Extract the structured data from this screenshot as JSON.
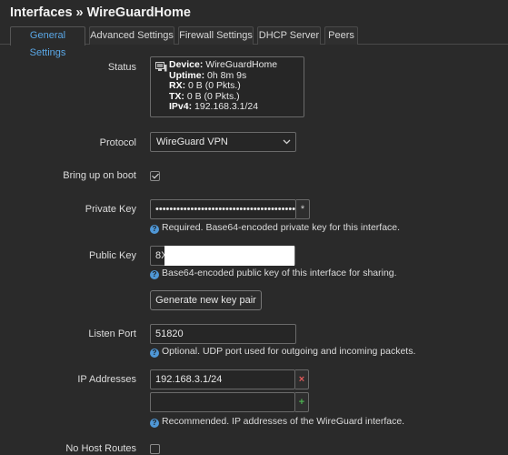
{
  "header": {
    "title": "Interfaces » WireGuardHome"
  },
  "tabs": [
    {
      "label": "General Settings",
      "active": true
    },
    {
      "label": "Advanced Settings",
      "active": false
    },
    {
      "label": "Firewall Settings",
      "active": false
    },
    {
      "label": "DHCP Server",
      "active": false
    },
    {
      "label": "Peers",
      "active": false
    }
  ],
  "status": {
    "label": "Status",
    "device_key": "Device:",
    "device_val": "WireGuardHome",
    "uptime_key": "Uptime:",
    "uptime_val": "0h 8m 9s",
    "rx_key": "RX:",
    "rx_val": "0 B (0 Pkts.)",
    "tx_key": "TX:",
    "tx_val": "0 B (0 Pkts.)",
    "ipv4_key": "IPv4:",
    "ipv4_val": "192.168.3.1/24"
  },
  "protocol": {
    "label": "Protocol",
    "value": "WireGuard VPN"
  },
  "bring_up": {
    "label": "Bring up on boot",
    "checked": true
  },
  "private_key": {
    "label": "Private Key",
    "value": "••••••••••••••••••••••••••••••••••••••••••••",
    "reveal": "*",
    "hint": "Required. Base64-encoded private key for this interface."
  },
  "public_key": {
    "label": "Public Key",
    "value": "8X",
    "hint": "Base64-encoded public key of this interface for sharing."
  },
  "generate_button": "Generate new key pair",
  "listen_port": {
    "label": "Listen Port",
    "value": "51820",
    "hint": "Optional. UDP port used for outgoing and incoming packets."
  },
  "ip_addresses": {
    "label": "IP Addresses",
    "values": [
      "192.168.3.1/24"
    ],
    "remove": "×",
    "add": "+",
    "hint": "Recommended. IP addresses of the WireGuard interface."
  },
  "no_host_routes": {
    "label": "No Host Routes",
    "checked": false
  },
  "colors": {
    "accent": "#5aa7e6",
    "help": "#4f97d6",
    "remove": "#e05a5a",
    "add": "#4caf50"
  },
  "icons": {
    "status": "network-device-icon",
    "protocol": "chevron-down-icon",
    "help": "question-icon"
  }
}
